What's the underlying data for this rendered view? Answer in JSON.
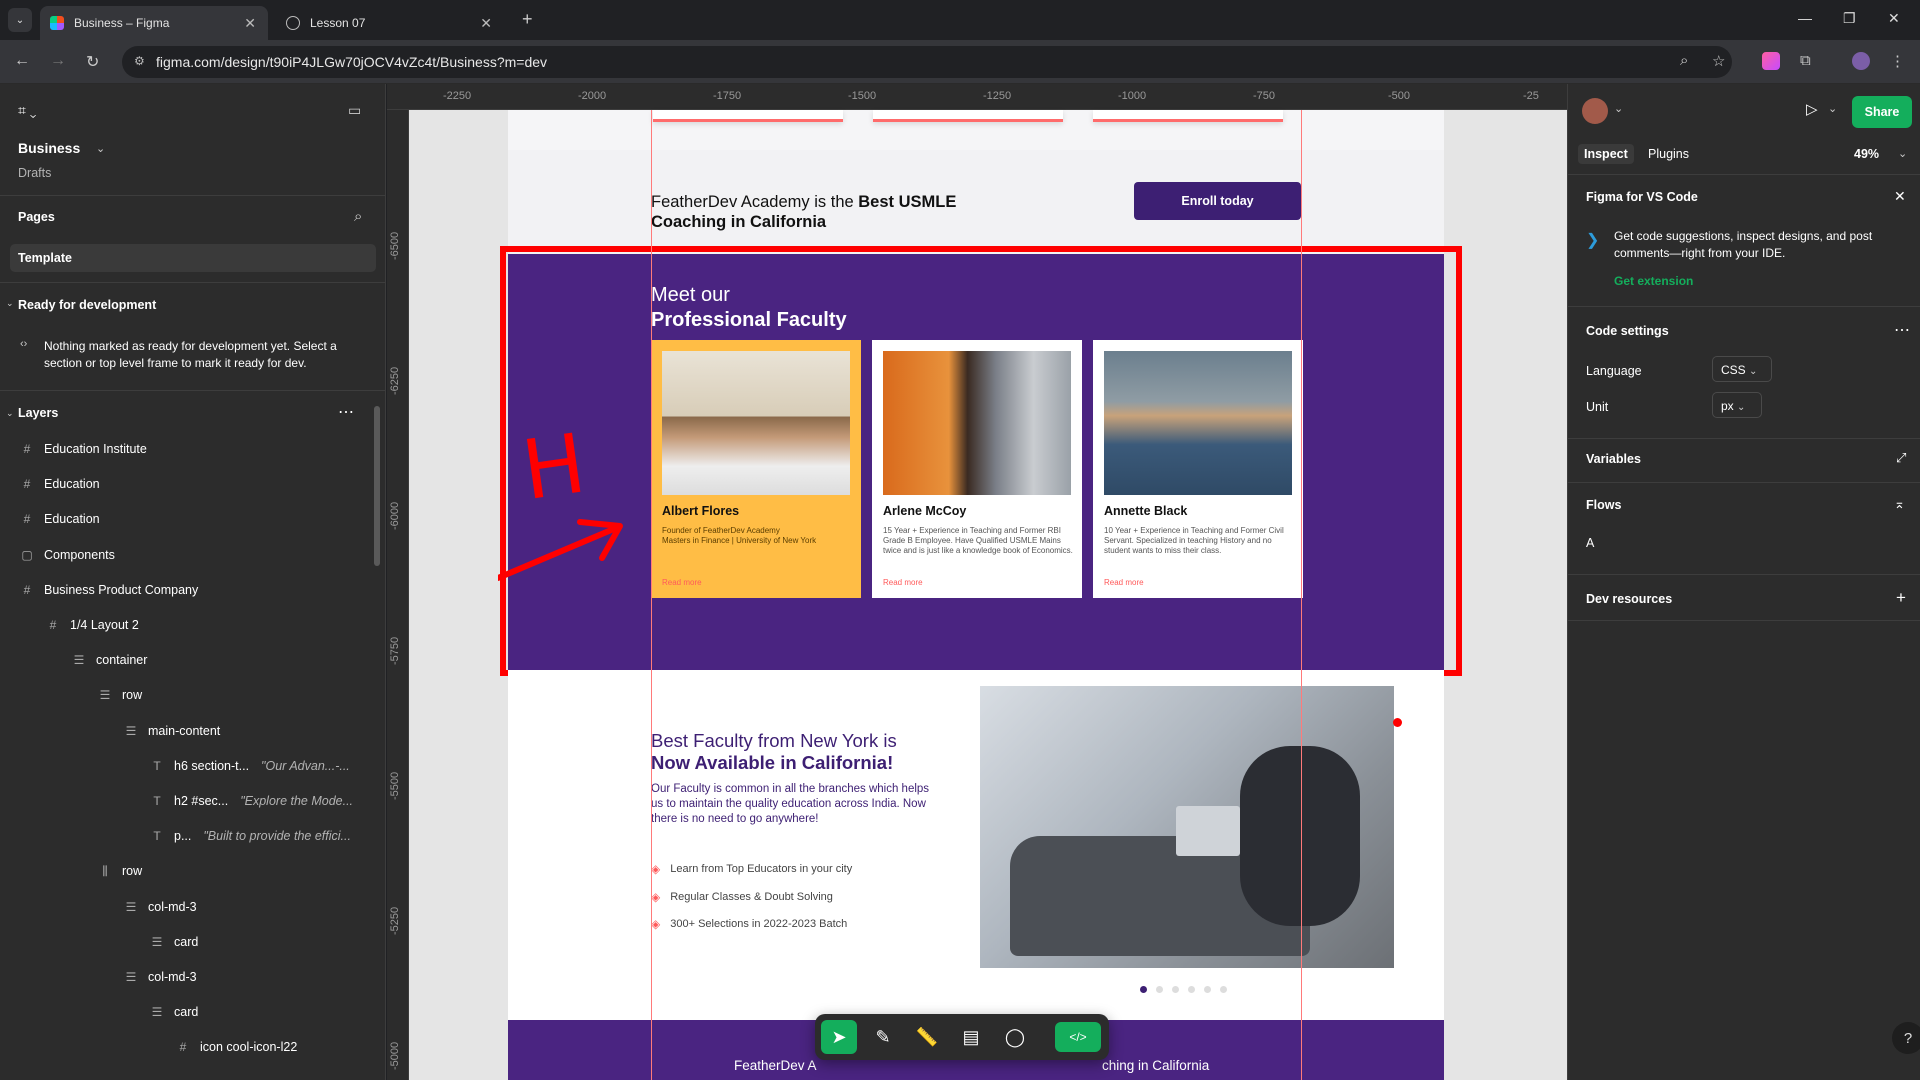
{
  "browser": {
    "tabs": [
      {
        "title": "Business – Figma",
        "active": true
      },
      {
        "title": "Lesson 07",
        "active": false
      }
    ],
    "url": "figma.com/design/t90iP4JLGw70jOCV4vZc4t/Business?m=dev"
  },
  "left_panel": {
    "file_name": "Business",
    "file_location": "Drafts",
    "pages_title": "Pages",
    "current_page": "Template",
    "ready_title": "Ready for development",
    "ready_msg": "Nothing marked as ready for development yet. Select a section or top level frame to mark it ready for dev.",
    "layers_title": "Layers",
    "layers": [
      {
        "name": "Education Institute",
        "icon": "frame-icon",
        "indent": 0
      },
      {
        "name": "Education",
        "icon": "frame-icon",
        "indent": 0
      },
      {
        "name": "Education",
        "icon": "frame-icon",
        "indent": 0
      },
      {
        "name": "Components",
        "icon": "section-icon",
        "indent": 0
      },
      {
        "name": "Business Product Company",
        "icon": "frame-icon",
        "indent": 0
      },
      {
        "name": "1/4 Layout 2",
        "icon": "frame-icon",
        "indent": 1
      },
      {
        "name": "container",
        "icon": "autolayout-vertical-icon",
        "indent": 2
      },
      {
        "name": "row",
        "icon": "autolayout-vertical-icon",
        "indent": 3
      },
      {
        "name": "main-content",
        "icon": "autolayout-vertical-icon",
        "indent": 4
      },
      {
        "name": "h6 section-t...",
        "icon": "text-icon",
        "indent": 5,
        "preview": "\"Our Advan...-..."
      },
      {
        "name": "h2 #sec...",
        "icon": "text-icon",
        "indent": 5,
        "preview": "\"Explore the Mode..."
      },
      {
        "name": "p...",
        "icon": "text-icon",
        "indent": 5,
        "preview": "\"Built to provide the effici..."
      },
      {
        "name": "row",
        "icon": "autolayout-horizontal-icon",
        "indent": 3
      },
      {
        "name": "col-md-3",
        "icon": "autolayout-vertical-icon",
        "indent": 4
      },
      {
        "name": "card",
        "icon": "autolayout-vertical-icon",
        "indent": 5
      },
      {
        "name": "col-md-3",
        "icon": "autolayout-vertical-icon",
        "indent": 4
      },
      {
        "name": "card",
        "icon": "autolayout-vertical-icon",
        "indent": 5
      },
      {
        "name": "icon cool-icon-l22",
        "icon": "frame-icon",
        "indent": 6
      }
    ]
  },
  "rulers": {
    "top": [
      "-2250",
      "-2000",
      "-1750",
      "-1500",
      "-1250",
      "-1000",
      "-750",
      "-500",
      "-25"
    ],
    "left": [
      "-6500",
      "-6250",
      "-6000",
      "-5750",
      "-5500",
      "-5250",
      "-5000"
    ]
  },
  "design": {
    "cta_text_plain": "FeatherDev Academy is the ",
    "cta_text_bold": "Best USMLE Coaching in California",
    "cta_button": "Enroll today",
    "faculty_heading_1": "Meet our",
    "faculty_heading_2": "Professional Faculty",
    "cards": [
      {
        "name": "Albert Flores",
        "desc": "Founder of FeatherDev Academy\nMasters in Finance | University of New York",
        "more": "Read more"
      },
      {
        "name": "Arlene McCoy",
        "desc": "15 Year + Experience in Teaching and Former RBI Grade B Employee. Have Qualified USMLE Mains twice and is just like a knowledge book of Economics.",
        "more": "Read more"
      },
      {
        "name": "Annette Black",
        "desc": "10 Year + Experience in Teaching and Former Civil Servant. Specialized in teaching History and no student wants to miss their class.",
        "more": "Read more"
      }
    ],
    "best_heading_1": "Best Faculty from New York is",
    "best_heading_2": "Now Available in California!",
    "best_paragraph": "Our Faculty is common in all the branches which helps us to maintain the quality education across India. Now there is no need to go anywhere!",
    "best_list": [
      "Learn from Top Educators in your city",
      "Regular Classes & Doubt Solving",
      "300+ Selections in 2022-2023 Batch"
    ],
    "footer_left": "FeatherDev A",
    "footer_right": "ching in California",
    "annotation_letter": "H"
  },
  "right_panel": {
    "tabs": [
      "Inspect",
      "Plugins"
    ],
    "zoom": "49%",
    "share": "Share",
    "vscode_title": "Figma for VS Code",
    "vscode_msg": "Get code suggestions, inspect designs, and post comments—right from your IDE.",
    "vscode_link": "Get extension",
    "code_settings": "Code settings",
    "language_label": "Language",
    "language_value": "CSS",
    "unit_label": "Unit",
    "unit_value": "px",
    "variables": "Variables",
    "flows": "Flows",
    "flow_item": "A",
    "dev_resources": "Dev resources"
  },
  "colors": {
    "faculty_bg": "#4a2481",
    "cta_button": "#3d1f73",
    "card_highlight": "#ffbd45",
    "figma_green": "#14ae5c",
    "annotation_red": "#ff0000"
  }
}
